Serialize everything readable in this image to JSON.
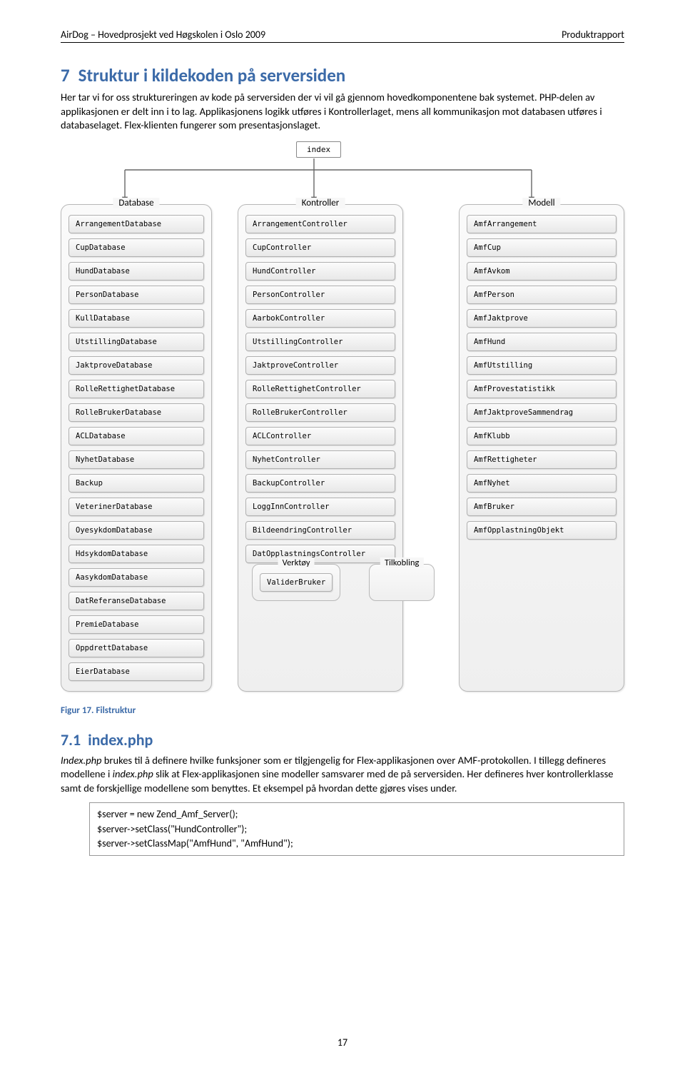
{
  "header": {
    "left": "AirDog – Hovedprosjekt ved Høgskolen i Oslo 2009",
    "right": "Produktrapport"
  },
  "h1_num": "7",
  "h1_text": "Struktur i kildekoden på serversiden",
  "intro_p1_a": "Her tar vi for oss struktureringen av kode på serversiden der vi vil gå gjennom hovedkomponentene bak systemet. PHP-delen av applikasjonen er delt inn i to lag. Applikasjonens logikk utføres i Kontrollerlaget, mens all kommunikasjon mot databasen utføres i databaselaget. Flex-klienten fungerer som presentasjonslaget.",
  "diagram": {
    "top": "index",
    "columns": [
      {
        "title": "Database",
        "cls": "database",
        "items": [
          "ArrangementDatabase",
          "CupDatabase",
          "HundDatabase",
          "PersonDatabase",
          "KullDatabase",
          "UtstillingDatabase",
          "JaktproveDatabase",
          "RolleRettighetDatabase",
          "RolleBrukerDatabase",
          "ACLDatabase",
          "NyhetDatabase",
          "Backup",
          "VeterinerDatabase",
          "OyesykdomDatabase",
          "HdsykdomDatabase",
          "AasykdomDatabase",
          "DatReferanseDatabase",
          "PremieDatabase",
          "OppdrettDatabase",
          "EierDatabase"
        ]
      },
      {
        "title": "Kontroller",
        "cls": "kontroller",
        "items": [
          "ArrangementController",
          "CupController",
          "HundController",
          "PersonController",
          "AarbokController",
          "UtstillingController",
          "JaktproveController",
          "RolleRettighetController",
          "RolleBrukerController",
          "ACLController",
          "NyhetController",
          "BackupController",
          "LoggInnController",
          "BildeendringController",
          "DatOpplastningsController"
        ]
      },
      {
        "title": "Modell",
        "cls": "modell",
        "items": [
          "AmfArrangement",
          "AmfCup",
          "AmfAvkom",
          "AmfPerson",
          "AmfJaktprove",
          "AmfHund",
          "AmfUtstilling",
          "AmfProvestatistikk",
          "AmfJaktproveSammendrag",
          "AmfKlubb",
          "AmfRettigheter",
          "AmfNyhet",
          "AmfBruker",
          "AmfOpplastningObjekt"
        ]
      }
    ],
    "subboxes": [
      {
        "title": "Verktøy",
        "items": [
          "ValiderBruker"
        ]
      },
      {
        "title": "Tilkobling",
        "items": []
      }
    ]
  },
  "caption": "Figur 17. Filstruktur",
  "h2_num": "7.1",
  "h2_text": "index.php",
  "p2_prefix": "Index.php",
  "p2_a": " brukes til å definere hvilke funksjoner som er tilgjengelig for Flex-applikasjonen over AMF-protokollen. I tillegg defineres modellene i ",
  "p2_mid": "index.php",
  "p2_b": " slik at Flex-applikasjonen sine modeller samsvarer med de på serversiden. Her defineres hver kontrollerklasse samt de forskjellige modellene som benyttes. Et eksempel på hvordan dette gjøres vises under.",
  "code": {
    "l1": "$server = new Zend_Amf_Server();",
    "l2": "$server->setClass(\"HundController\");",
    "l3": "$server->setClassMap(\"AmfHund\", \"AmfHund\");"
  },
  "pagenum": "17"
}
